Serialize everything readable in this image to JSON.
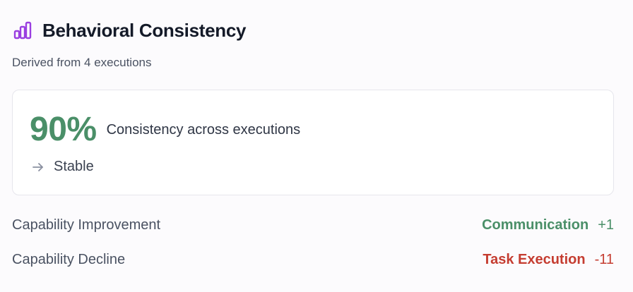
{
  "header": {
    "title": "Behavioral Consistency",
    "icon": "bar-chart-icon",
    "icon_color": "#9a3fe0"
  },
  "subtitle": "Derived from 4 executions",
  "consistency": {
    "value": "90%",
    "label": "Consistency across executions",
    "trend_icon": "arrow-right-icon",
    "trend_label": "Stable",
    "value_color": "#4a8f68"
  },
  "capabilities": [
    {
      "label": "Capability Improvement",
      "name": "Communication",
      "delta": "+1",
      "color": "#4a8f68"
    },
    {
      "label": "Capability Decline",
      "name": "Task Execution",
      "delta": "-11",
      "color": "#c53d31"
    }
  ]
}
